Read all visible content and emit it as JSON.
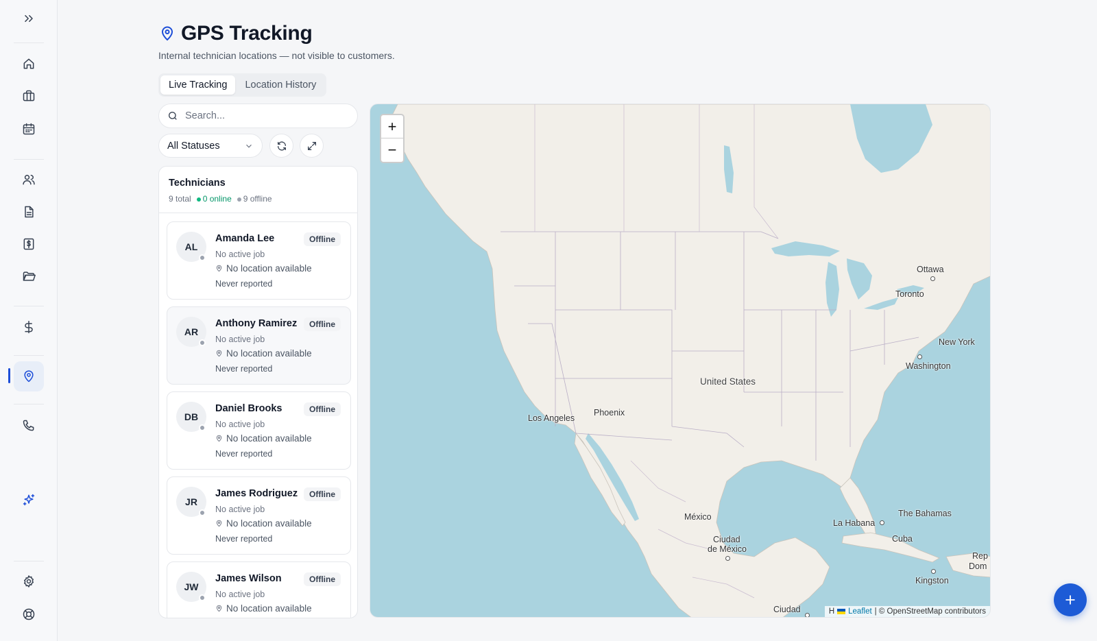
{
  "sidebar": {
    "items": [
      {
        "icon": "chevrons-right-icon"
      },
      {
        "icon": "home-icon"
      },
      {
        "icon": "briefcase-icon"
      },
      {
        "icon": "calendar-icon"
      },
      {
        "icon": "users-icon"
      },
      {
        "icon": "document-icon"
      },
      {
        "icon": "invoice-icon"
      },
      {
        "icon": "folder-icon"
      },
      {
        "icon": "dollar-icon"
      },
      {
        "icon": "map-pin-icon",
        "active": true
      },
      {
        "icon": "phone-icon"
      },
      {
        "icon": "sparkles-icon"
      },
      {
        "icon": "gear-icon"
      },
      {
        "icon": "support-icon"
      }
    ],
    "accent": "#1d4ed8"
  },
  "header": {
    "title": "GPS Tracking",
    "subtitle": "Internal technician locations — not visible to customers."
  },
  "tabs": [
    {
      "label": "Live Tracking",
      "active": true
    },
    {
      "label": "Location History",
      "active": false
    }
  ],
  "search": {
    "placeholder": "Search...",
    "value": ""
  },
  "filter": {
    "selected": "All Statuses"
  },
  "technicians": {
    "title": "Technicians",
    "total": "9 total",
    "online": "0 online",
    "offline": "9 offline",
    "list": [
      {
        "initials": "AL",
        "name": "Amanda Lee",
        "status": "Offline",
        "job": "No active job",
        "location": "No location available",
        "reported": "Never reported"
      },
      {
        "initials": "AR",
        "name": "Anthony Ramirez",
        "status": "Offline",
        "job": "No active job",
        "location": "No location available",
        "reported": "Never reported"
      },
      {
        "initials": "DB",
        "name": "Daniel Brooks",
        "status": "Offline",
        "job": "No active job",
        "location": "No location available",
        "reported": "Never reported"
      },
      {
        "initials": "JR",
        "name": "James Rodriguez",
        "status": "Offline",
        "job": "No active job",
        "location": "No location available",
        "reported": "Never reported"
      },
      {
        "initials": "JW",
        "name": "James Wilson",
        "status": "Offline",
        "job": "No active job",
        "location": "No location available",
        "reported": ""
      }
    ]
  },
  "map": {
    "zoom_in": "+",
    "zoom_out": "−",
    "attribution_link": "Leaflet",
    "attribution_text": "| © OpenStreetMap contributors",
    "attribution_prefix": "H",
    "labels": {
      "ottawa": "Ottawa",
      "toronto": "Toronto",
      "new_york": "New York",
      "washington": "Washington",
      "united_states": "United States",
      "phoenix": "Phoenix",
      "los_angeles": "Los Angeles",
      "mexico": "México",
      "ciudad_mexico_1": "Ciudad",
      "ciudad_mexico_2": "de México",
      "la_habana": "La Habana",
      "bahamas": "The Bahamas",
      "cuba": "Cuba",
      "kingston": "Kingston",
      "rep": "Rep",
      "dom": "Dom",
      "ciudad_bottom": "Ciudad"
    },
    "water_color": "#aad3df",
    "land_color": "#f2efe9"
  },
  "fab": {
    "icon": "plus-icon"
  }
}
